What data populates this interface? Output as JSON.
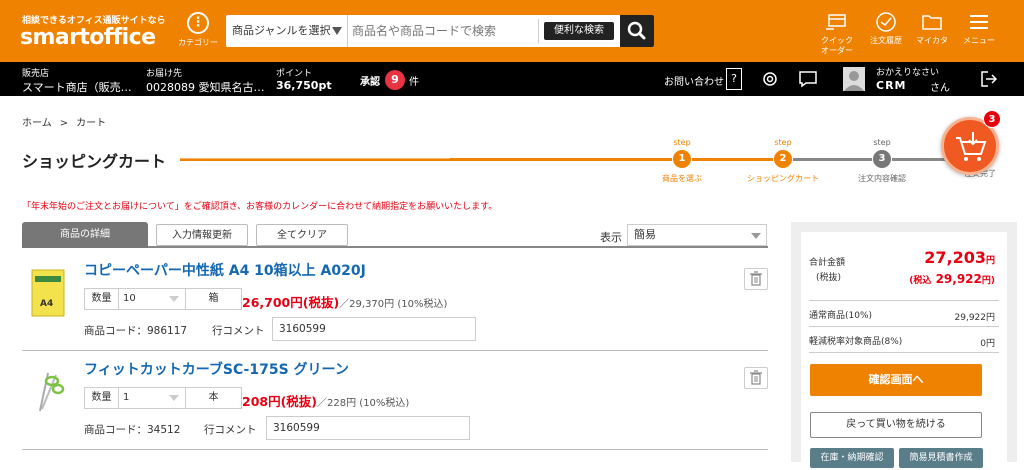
{
  "header": {
    "tagline": "相談できるオフィス通販サイトなら",
    "logo": "smartoffice",
    "category_label": "カテゴリー",
    "search": {
      "genre_select": "商品ジャンルを選択",
      "placeholder": "商品名や商品コードで検索",
      "advanced_button": "便利な検索"
    },
    "nav": [
      {
        "label": "クイック\nオーダー",
        "icon": "quick-order-icon"
      },
      {
        "label": "注文履歴",
        "icon": "order-history-icon"
      },
      {
        "label": "マイカタ",
        "icon": "folder-icon"
      },
      {
        "label": "メニュー",
        "icon": "hamburger-menu-icon"
      }
    ],
    "accent_color": "#ef8200"
  },
  "subbar": {
    "shop_label": "販売店",
    "shop_name": "スマート商店（販売…",
    "delivery_label": "お届け先",
    "delivery_value": "0028089 愛知県名古…",
    "points_label": "ポイント",
    "points_value": "36,750pt",
    "approval_label": "承認",
    "approval_count": "9",
    "approval_unit": "件",
    "contact": "お問い合わせ",
    "help": "?",
    "greeting": "おかえりなさい",
    "user_name": "CRM",
    "honorific": "さん"
  },
  "breadcrumb": [
    "ホーム",
    ">",
    "カート"
  ],
  "page_title": "ショッピングカート",
  "steps": [
    {
      "top": "step",
      "num": "1",
      "label": "商品を選ぶ",
      "state": "done"
    },
    {
      "top": "step",
      "num": "2",
      "label": "ショッピングカート",
      "state": "current"
    },
    {
      "top": "step",
      "num": "3",
      "label": "注文内容確認",
      "state": "todo"
    },
    {
      "top": "",
      "num": "",
      "label": "注文完了",
      "state": "todo"
    }
  ],
  "cart_badge": "3",
  "notice": "「年末年始のご注文とお届けについて」をご確認頂き、お客様のカレンダーに合わせて納期指定をお願いいたします。",
  "tabs": {
    "details": "商品の詳細",
    "update": "入力情報更新",
    "clear": "全てクリア",
    "display_label": "表示",
    "display_value": "簡易"
  },
  "items": [
    {
      "name": "コピーペーパー中性紙 A4 10箱以上 A020J",
      "qty_label": "数量",
      "qty": "10",
      "unit": "箱",
      "price_excl": "26,700円(税抜)",
      "price_incl": "／29,370円 (10%税込)",
      "code_label": "商品コード：",
      "code": "986117",
      "comment_label": "行コメント",
      "comment": "3160599"
    },
    {
      "name": "フィットカットカーブSC-175S グリーン",
      "qty_label": "数量",
      "qty": "1",
      "unit": "本",
      "price_excl": "208円(税抜)",
      "price_incl": "／228円 (10%税込)",
      "code_label": "商品コード：",
      "code": "34512",
      "comment_label": "行コメント",
      "comment": "3160599"
    }
  ],
  "summary": {
    "total_label": "合計金額",
    "total_sublabel": "(税抜)",
    "total_value": "27,203",
    "total_unit": "円",
    "taxin_prefix": "(税込",
    "taxin_value": "29,922",
    "taxin_unit": "円)",
    "normal_label": "通常商品(10%)",
    "normal_value": "29,922円",
    "reduced_label": "軽減税率対象商品(8%)",
    "reduced_value": "0円",
    "confirm_button": "確認画面へ",
    "continue_button": "戻って買い物を続ける",
    "stock_button": "在庫・納期確認",
    "quote_button": "簡易見積書作成"
  }
}
